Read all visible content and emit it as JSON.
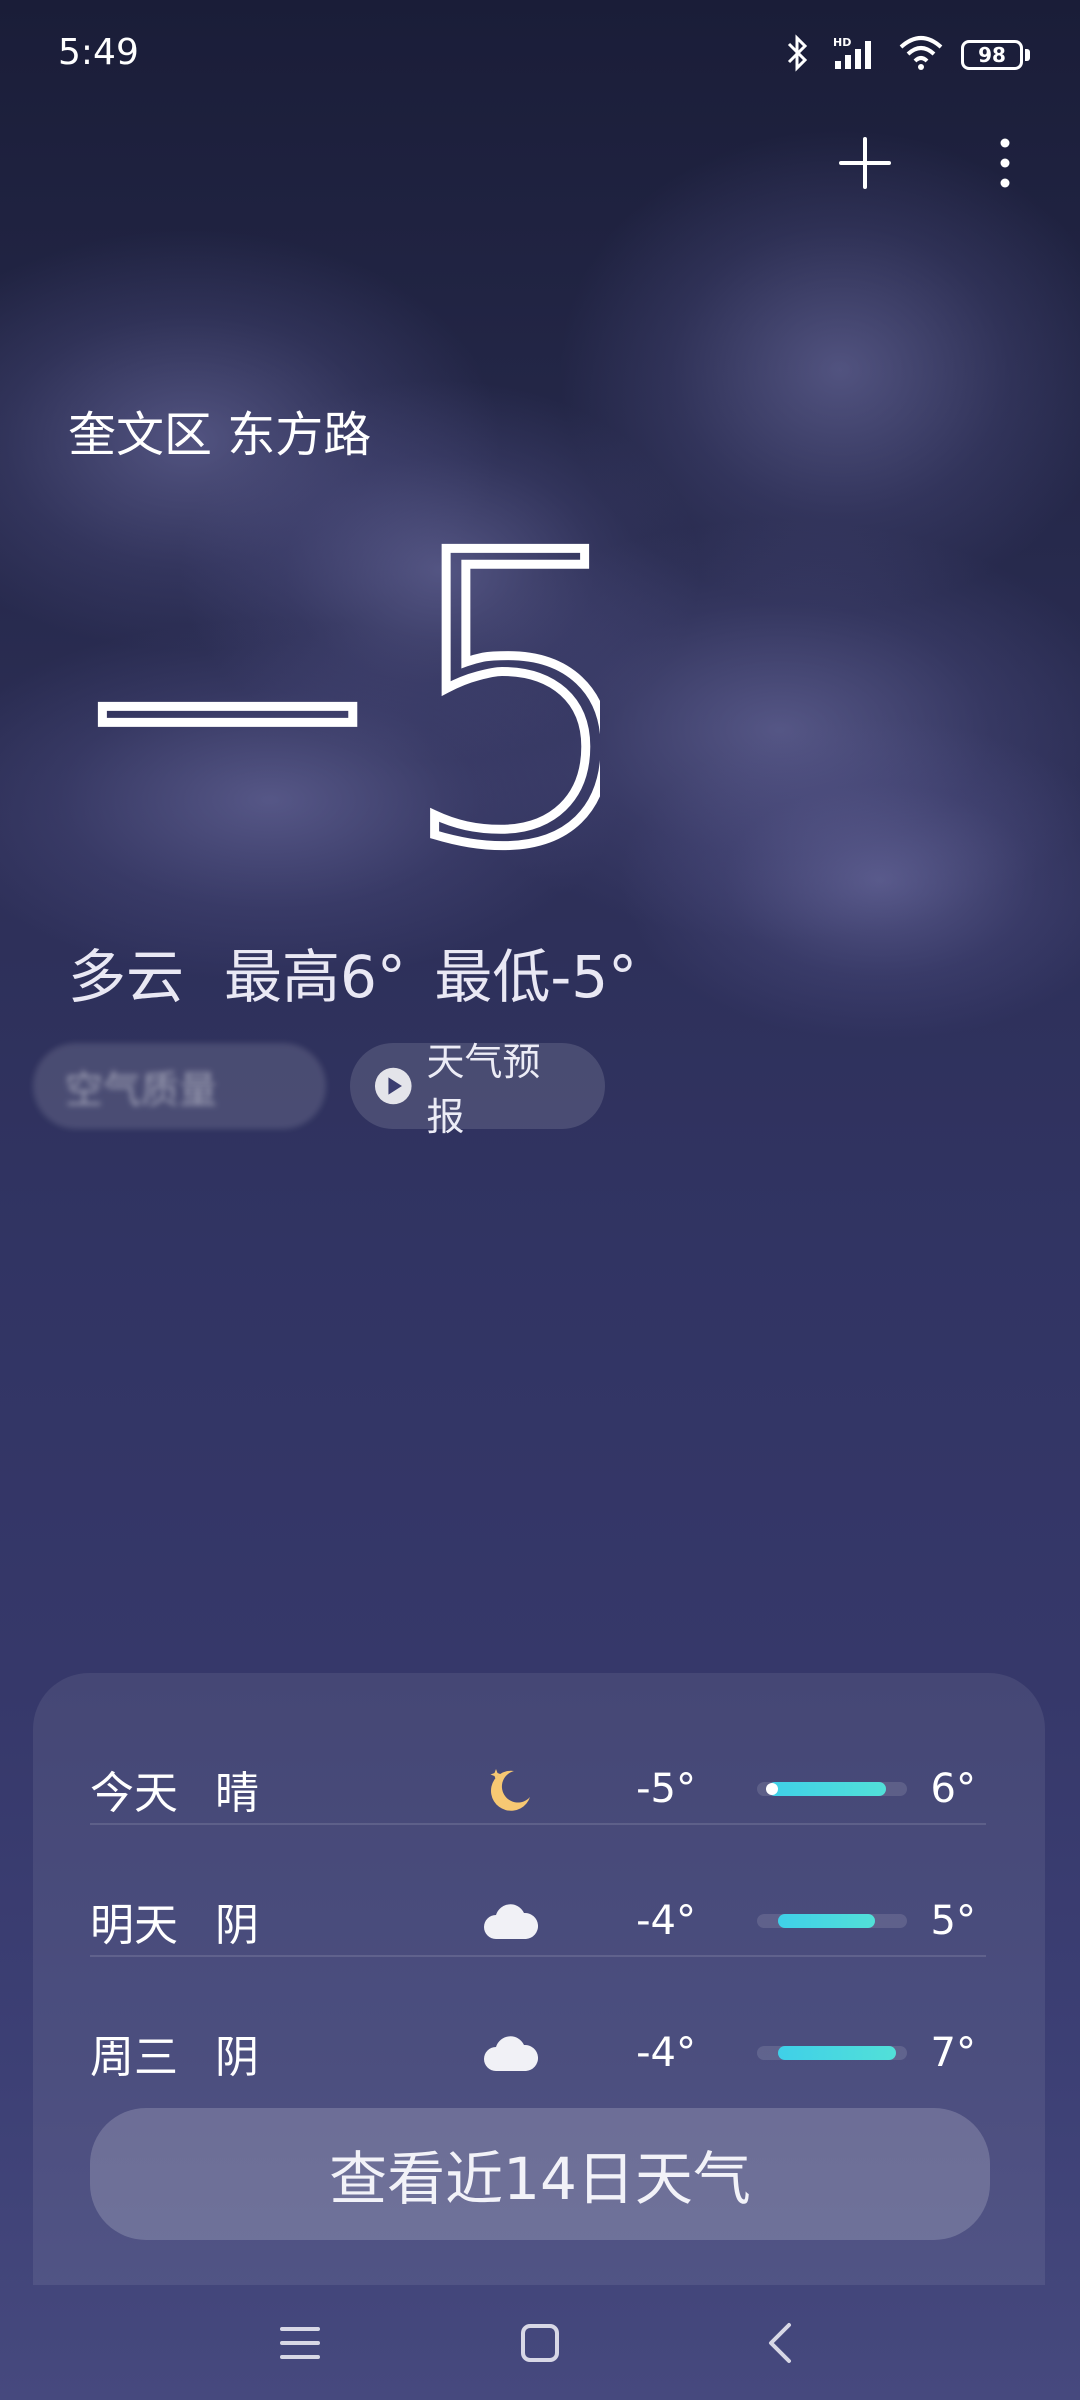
{
  "status": {
    "time": "5:49",
    "battery": "98",
    "icons": [
      "bluetooth-icon",
      "hd-signal-icon",
      "wifi-icon",
      "battery-icon"
    ]
  },
  "toolbar": {
    "icons": [
      "plus-icon",
      "more-vert-icon"
    ]
  },
  "location": "奎文区 东方路",
  "current": {
    "temperature": "−5°",
    "condition": "多云",
    "high_low": "最高6° 最低-5°"
  },
  "chips": {
    "blurred_label": "空气质量",
    "forecast_label": "天气预报",
    "forecast_icon": "play-circle-icon"
  },
  "forecast": [
    {
      "day": "今天",
      "weather": "晴",
      "icon": "moon-star-icon",
      "low": "-5°",
      "high": "6°",
      "low_val": -5,
      "high_val": 6,
      "current_val": -5
    },
    {
      "day": "明天",
      "weather": "阴",
      "icon": "cloud-icon",
      "low": "-4°",
      "high": "5°",
      "low_val": -4,
      "high_val": 5
    },
    {
      "day": "周三",
      "weather": "阴",
      "icon": "cloud-icon",
      "low": "-4°",
      "high": "7°",
      "low_val": -4,
      "high_val": 7
    }
  ],
  "forecast_range": {
    "min": -6,
    "max": 8
  },
  "cta_label": "查看近14日天气",
  "navbar": {
    "icons": [
      "menu-icon",
      "home-icon",
      "back-icon"
    ]
  },
  "colors": {
    "bar_fill": "#3fd0e8",
    "moon": "#f7c873"
  }
}
